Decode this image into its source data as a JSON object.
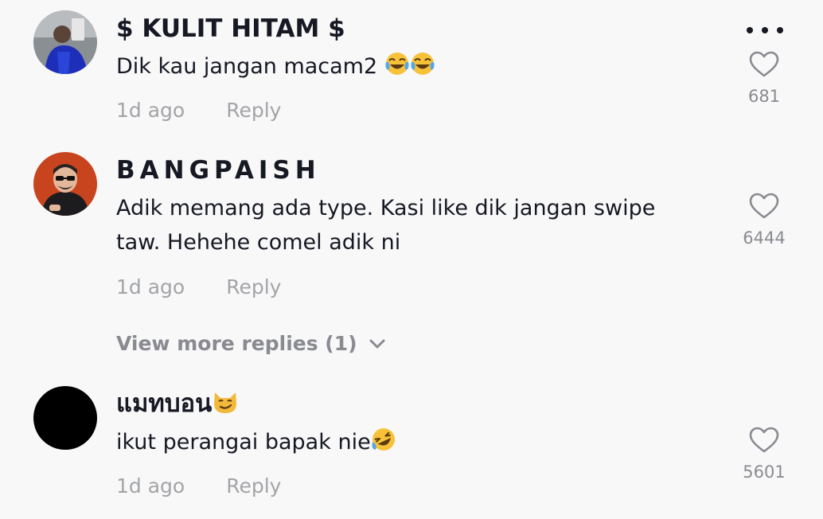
{
  "more_icon": "more-horizontal-icon",
  "comments": [
    {
      "username": "$ KULIT HITAM $",
      "text": "Dik kau jangan macam2",
      "emoji": "tears-of-joy-emoji x2",
      "time": "1d ago",
      "reply_label": "Reply",
      "like_count": "681",
      "like_icon": "heart-outline-icon"
    },
    {
      "username": "BANGPAISH",
      "text_line1": "Adik memang ada type. Kasi like dik jangan swipe",
      "text_line2": "taw. Hehehe comel adik ni",
      "time": "1d ago",
      "reply_label": "Reply",
      "like_count": "6444",
      "like_icon": "heart-outline-icon"
    },
    {
      "username": "แมทบอน",
      "username_emoji": "smirking-cat-emoji",
      "text": "ikut perangai bapak nie",
      "emoji": "rolling-on-floor-laughing-emoji",
      "time": "1d ago",
      "reply_label": "Reply",
      "like_count": "5601",
      "like_icon": "heart-outline-icon"
    }
  ],
  "view_more": {
    "label": "View more replies (1)",
    "icon": "chevron-down-icon"
  },
  "colors": {
    "background": "#f8f8f8",
    "primary_text": "#161823",
    "secondary_text": "#a3a4a8",
    "count_text": "#8a8b91"
  }
}
